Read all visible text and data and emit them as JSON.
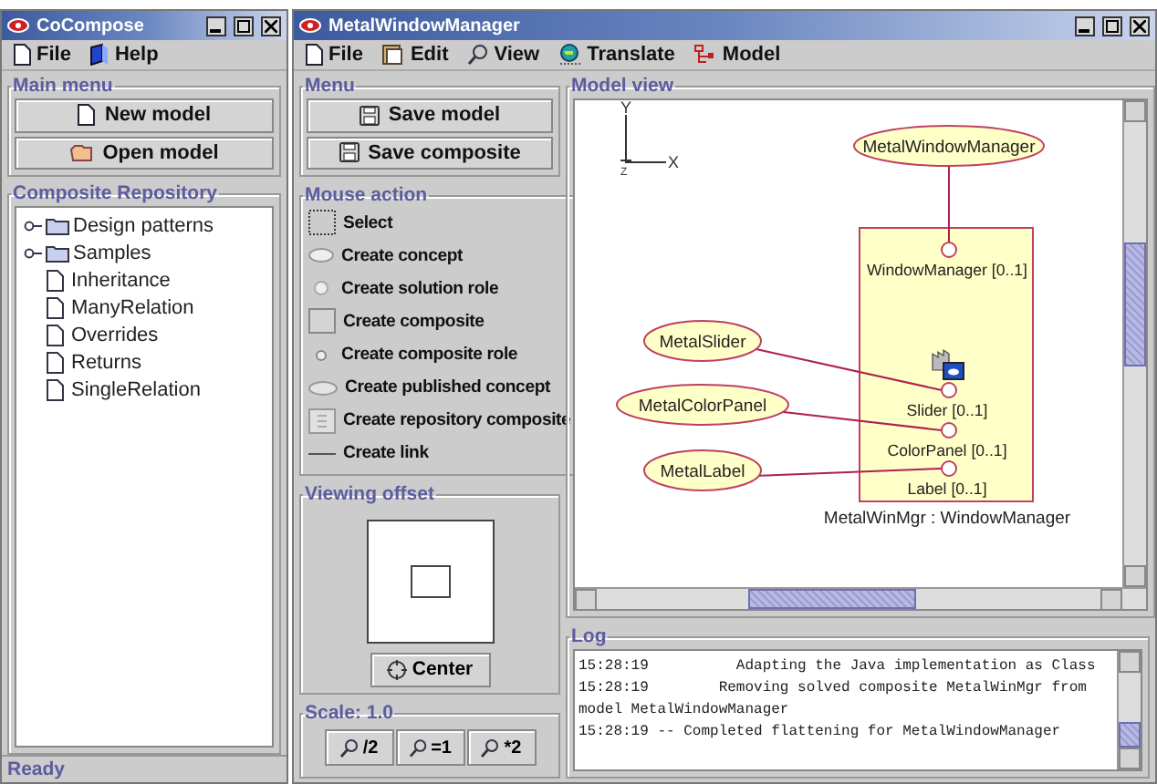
{
  "left_window": {
    "title": "CoCompose",
    "menu": [
      {
        "label": "File"
      },
      {
        "label": "Help"
      }
    ],
    "main_menu": {
      "title": "Main menu",
      "buttons": [
        {
          "label": "New model"
        },
        {
          "label": "Open model"
        }
      ]
    },
    "repository": {
      "title": "Composite Repository",
      "items": [
        {
          "label": "Design patterns",
          "kind": "folder"
        },
        {
          "label": "Samples",
          "kind": "folder"
        },
        {
          "label": "Inheritance",
          "kind": "file"
        },
        {
          "label": "ManyRelation",
          "kind": "file"
        },
        {
          "label": "Overrides",
          "kind": "file"
        },
        {
          "label": "Returns",
          "kind": "file"
        },
        {
          "label": "SingleRelation",
          "kind": "file"
        }
      ]
    },
    "status_bar": "Ready"
  },
  "right_window": {
    "title": "MetalWindowManager",
    "menu": [
      {
        "label": "File"
      },
      {
        "label": "Edit"
      },
      {
        "label": "View"
      },
      {
        "label": "Translate"
      },
      {
        "label": "Model"
      }
    ],
    "menu_panel": {
      "title": "Menu",
      "buttons": [
        {
          "label": "Save model"
        },
        {
          "label": "Save composite"
        }
      ]
    },
    "mouse_action": {
      "title": "Mouse action",
      "items": [
        {
          "label": "Select",
          "kind": "select"
        },
        {
          "label": "Create concept",
          "kind": "concept"
        },
        {
          "label": "Create solution role",
          "kind": "solution-role"
        },
        {
          "label": "Create composite",
          "kind": "composite"
        },
        {
          "label": "Create composite role",
          "kind": "composite-role"
        },
        {
          "label": "Create published concept",
          "kind": "published-concept"
        },
        {
          "label": "Create repository composite",
          "kind": "repository-composite"
        },
        {
          "label": "Create link",
          "kind": "link"
        }
      ]
    },
    "viewing_offset": {
      "title": "Viewing offset",
      "button": "Center"
    },
    "scale": {
      "title": "Scale: 1.0",
      "buttons": [
        "/2",
        "=1",
        "*2"
      ]
    },
    "model_view": {
      "title": "Model view",
      "axes": {
        "x": "X",
        "y": "Y",
        "z": "Z"
      },
      "composite": {
        "caption": "MetalWinMgr : WindowManager",
        "roles": [
          {
            "label": "WindowManager [0..1]",
            "concept": "MetalWindowManager"
          },
          {
            "label": "Slider [0..1]",
            "concept": "MetalSlider"
          },
          {
            "label": "ColorPanel [0..1]",
            "concept": "MetalColorPanel"
          },
          {
            "label": "Label [0..1]",
            "concept": "MetalLabel"
          }
        ]
      }
    },
    "log": {
      "title": "Log",
      "lines": [
        "15:28:19          Adapting the Java implementation as Class",
        "15:28:19        Removing solved composite MetalWinMgr from",
        "model MetalWindowManager",
        "15:28:19 -- Completed flattening for MetalWindowManager"
      ]
    }
  }
}
